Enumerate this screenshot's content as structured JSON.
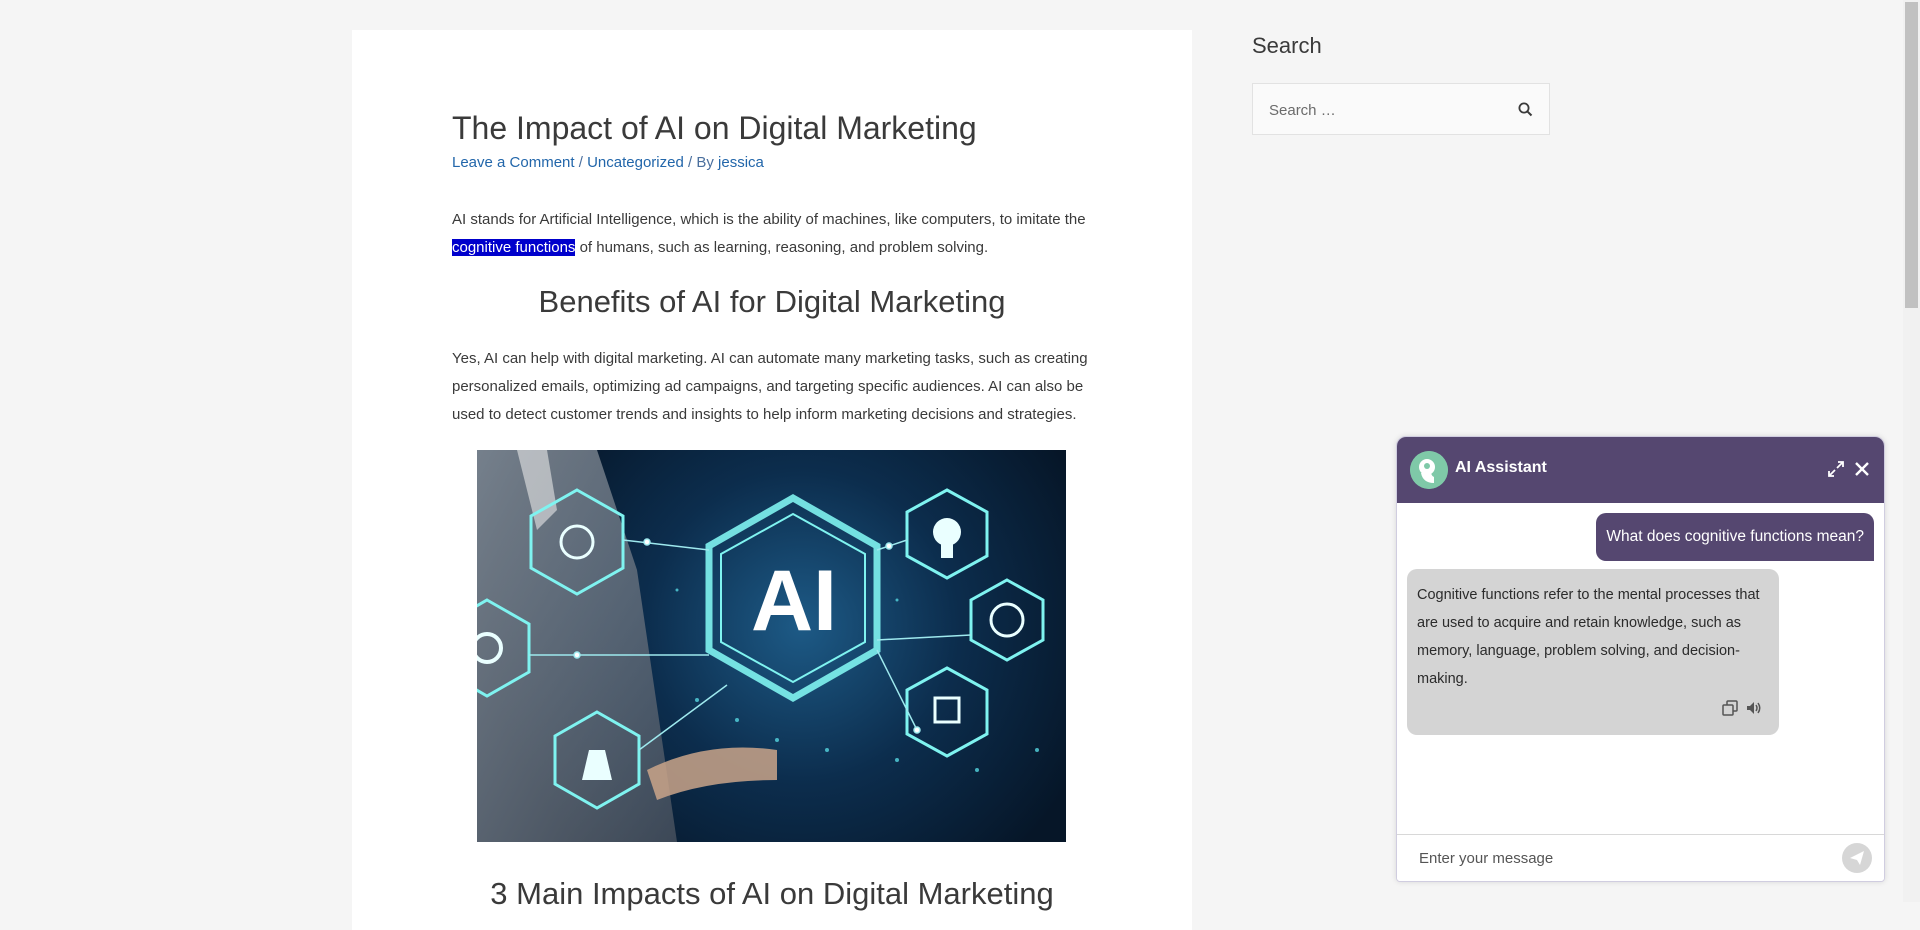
{
  "article": {
    "title": "The Impact of AI on Digital Marketing",
    "meta": {
      "comment_link": "Leave a Comment",
      "separator1": " / ",
      "category_link": "Uncategorized",
      "separator2": " / By ",
      "author_link": "jessica"
    },
    "intro": {
      "before": "AI stands for Artificial Intelligence, which is the ability of machines, like computers, to imitate the ",
      "highlight": "cognitive functions",
      "after": " of humans, such as learning, reasoning, and problem solving."
    },
    "heading2": "Benefits of AI for Digital Marketing",
    "paragraph2": "Yes, AI can help with digital marketing. AI can automate many marketing tasks, such as creating personalized emails, optimizing ad campaigns, and targeting specific audiences. AI can also be used to detect customer trends and insights to help inform marketing decisions and strategies.",
    "hero_image_text": "AI",
    "heading3": "3 Main Impacts of AI on Digital Marketing"
  },
  "sidebar": {
    "title": "Search",
    "search_placeholder": "Search …"
  },
  "chat": {
    "title": "AI Assistant",
    "user_message": "What does cognitive functions mean?",
    "bot_message": "Cognitive functions refer to the mental processes that are used to acquire and retain knowledge, such as memory, language, problem solving, and decision-making.",
    "input_placeholder": "Enter your message"
  },
  "colors": {
    "chat_header": "#554770",
    "link": "#2266aa",
    "highlight": "#0000cc"
  }
}
